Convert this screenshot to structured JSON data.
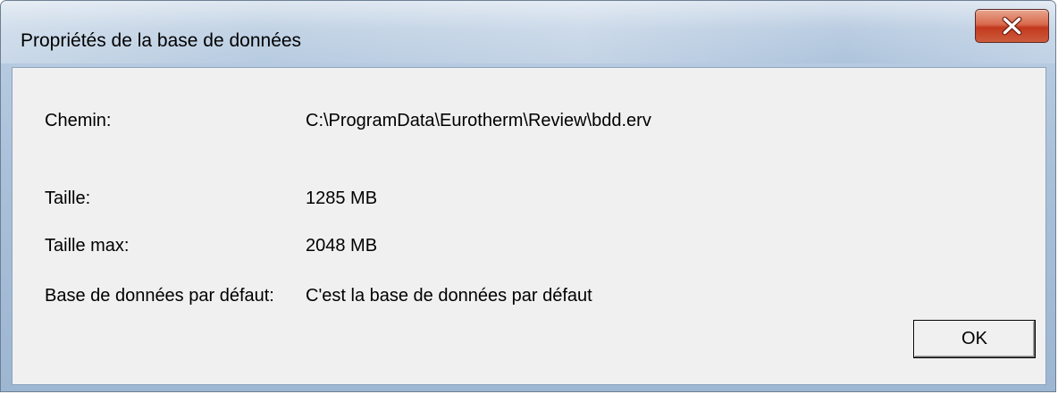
{
  "window": {
    "title": "Propriétés de la base de données",
    "close_icon": "close-icon"
  },
  "properties": {
    "path": {
      "label": "Chemin:",
      "value": "C:\\ProgramData\\Eurotherm\\Review\\bdd.erv"
    },
    "size": {
      "label": "Taille:",
      "value": "1285 MB"
    },
    "max_size": {
      "label": "Taille max:",
      "value": "2048 MB"
    },
    "default_db": {
      "label": "Base de données par défaut:",
      "value": "C'est la base de données par défaut"
    }
  },
  "buttons": {
    "ok_label": "OK"
  },
  "colors": {
    "close_button": "#c2391e",
    "client_background": "#f0f0f0",
    "frame": "#a9c0d9"
  }
}
